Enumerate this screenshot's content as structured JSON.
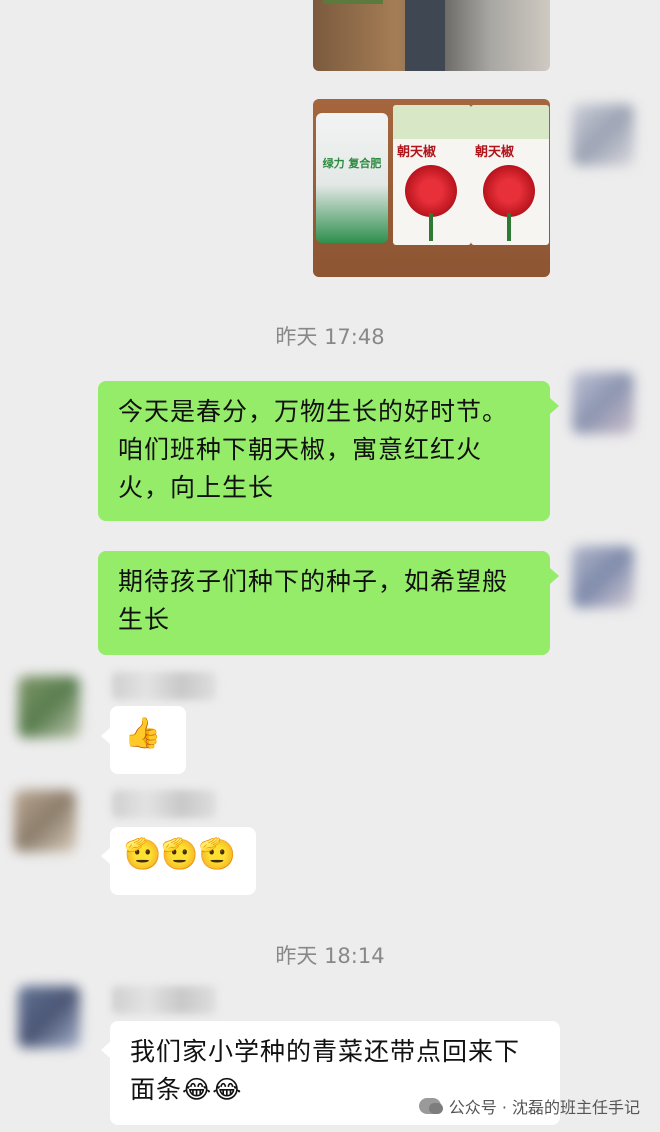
{
  "messages": {
    "time_1": "昨天 17:48",
    "msg_spring": "今天是春分，万物生长的好时节。咱们班种下朝天椒，寓意红红火火，向上生长",
    "msg_hope": "期待孩子们种下的种子，如希望般生长",
    "thumb_emoji": "👍",
    "salute_emoji": "🫡🫡🫡",
    "time_2": "昨天 18:14",
    "msg_veg": "我们家小学种的青菜还带点回来下面条😂😂"
  },
  "photo_seeds": {
    "bag_text": "绿力 复合肥",
    "pack_name": "朝天椒"
  },
  "watermark": {
    "text": "公众号 · 沈磊的班主任手记"
  }
}
